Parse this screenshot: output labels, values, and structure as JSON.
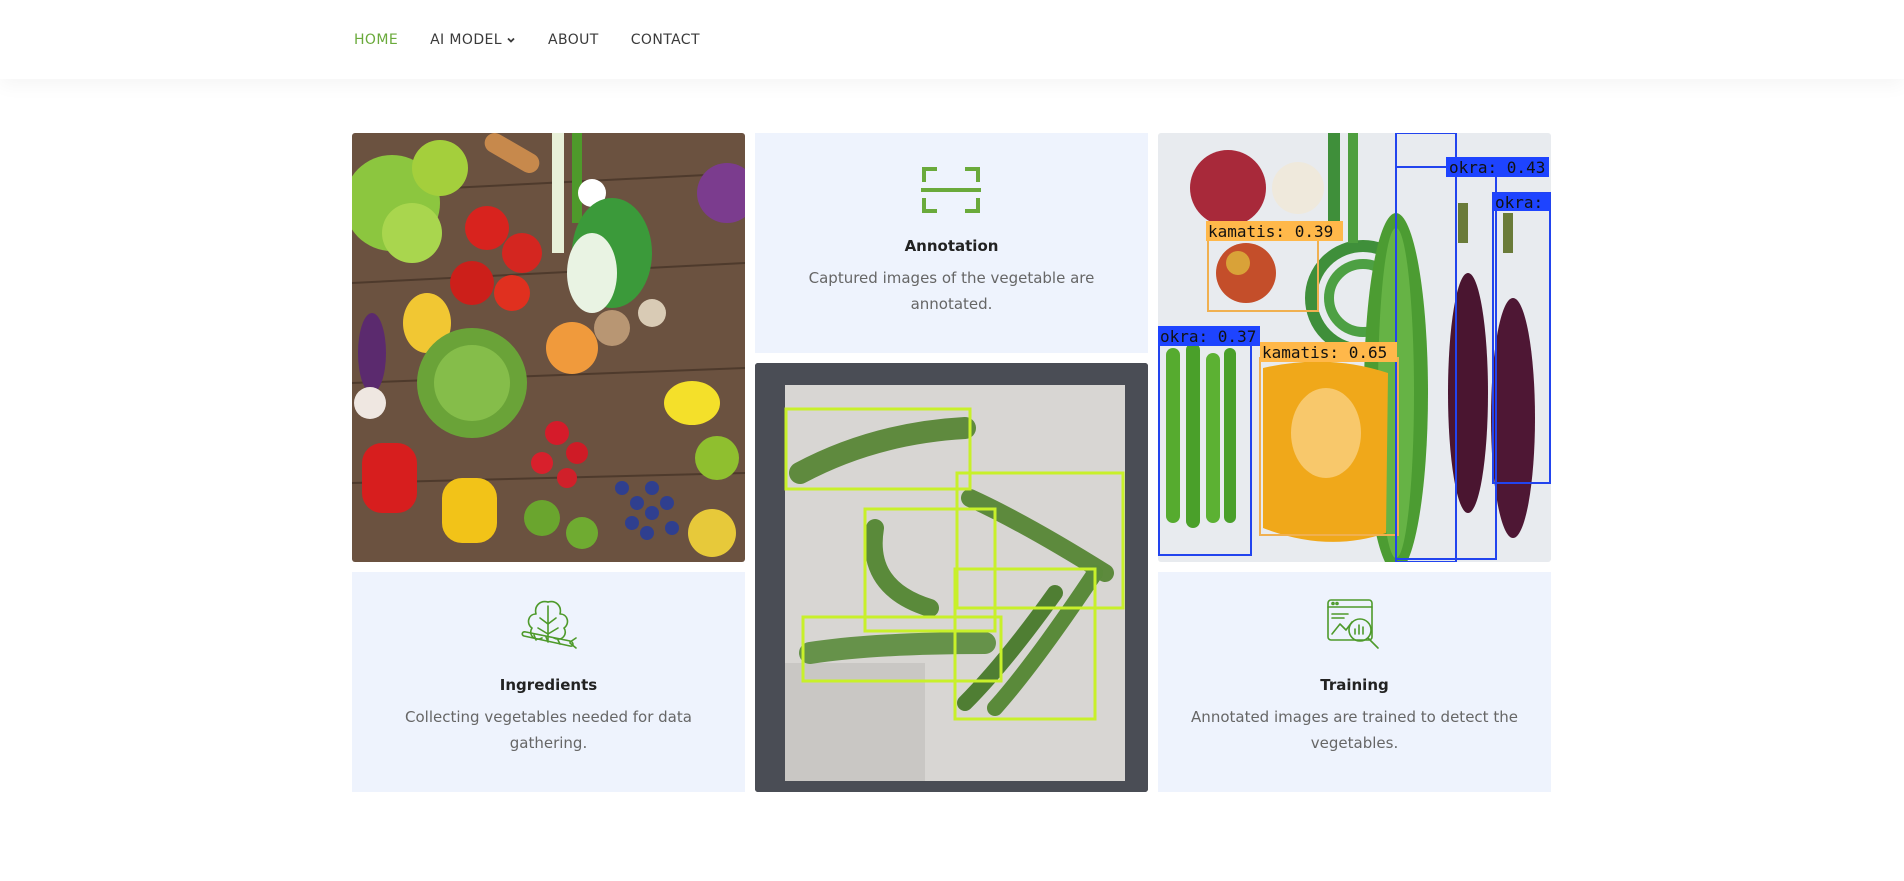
{
  "nav": {
    "items": [
      {
        "label": "HOME",
        "active": true
      },
      {
        "label": "AI MODEL",
        "dropdown": true
      },
      {
        "label": "ABOUT"
      },
      {
        "label": "CONTACT"
      }
    ]
  },
  "colors": {
    "accent": "#6aaa3b",
    "card_bg": "#eef3fd",
    "box_yellow": "#c8f02a",
    "box_blue": "#1e44ff",
    "label_orange": "#ffb84a"
  },
  "cards": {
    "annotation": {
      "icon": "scan-frame-icon",
      "title": "Annotation",
      "desc_line1": "Captured images of the vegetable are",
      "desc_line2": "annotated."
    },
    "ingredients": {
      "icon": "vegetables-icon",
      "title": "Ingredients",
      "desc_line1": "Collecting vegetables needed for data",
      "desc_line2": "gathering."
    },
    "training": {
      "icon": "image-search-icon",
      "title": "Training",
      "desc_line1": "Annotated images are trained to detect the",
      "desc_line2": "vegetables."
    }
  },
  "images": {
    "vegetables_photo": "vegetables-photo",
    "okra_annotation_photo": "okra-annotation-photo",
    "detection_photo": "detection-results-photo"
  },
  "detections": {
    "okra_1": "okra: 0.43",
    "okra_2": "okra:",
    "kamatis_1": "kamatis: 0.39",
    "okra_3": "okra: 0.37",
    "kamatis_2": "kamatis: 0.65"
  }
}
